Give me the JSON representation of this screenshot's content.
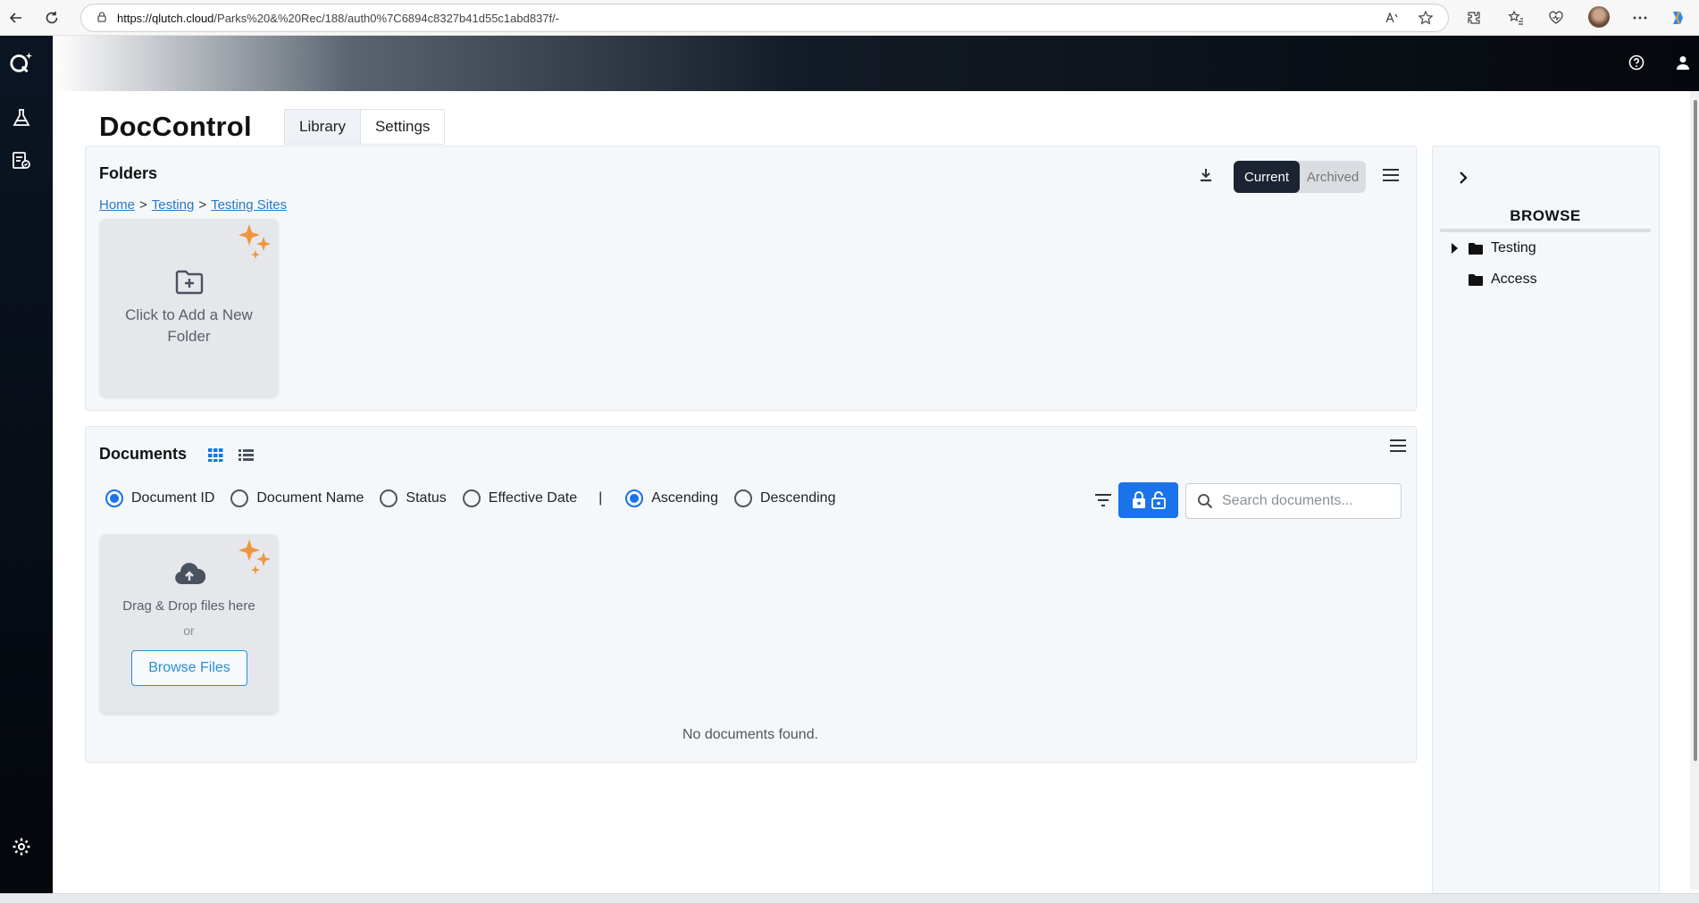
{
  "browser": {
    "url_host": "https://qlutch.cloud",
    "url_path": "/Parks%20&%20Rec/188/auth0%7C6894c8327b41d55c1abd837f/-"
  },
  "app": {
    "title": "DocControl",
    "tabs": [
      "Library",
      "Settings"
    ],
    "active_tab": "Library"
  },
  "folders": {
    "title": "Folders",
    "breadcrumb": [
      "Home",
      "Testing",
      "Testing Sites"
    ],
    "breadcrumb_sep": ">",
    "add_folder_label": "Click to Add a New Folder",
    "toggle": {
      "current": "Current",
      "archived": "Archived",
      "selected": "Current"
    }
  },
  "documents": {
    "title": "Documents",
    "sort_fields": [
      "Document ID",
      "Document Name",
      "Status",
      "Effective Date"
    ],
    "sort_field_selected": "Document ID",
    "sort_separator": "|",
    "sort_orders": [
      "Ascending",
      "Descending"
    ],
    "sort_order_selected": "Ascending",
    "search_placeholder": "Search documents...",
    "drop_label": "Drag & Drop files here",
    "or_label": "or",
    "browse_button": "Browse Files",
    "empty_message": "No documents found."
  },
  "browse": {
    "title": "BROWSE",
    "items": [
      {
        "label": "Testing",
        "expandable": true
      },
      {
        "label": "Access",
        "expandable": false
      }
    ]
  },
  "colors": {
    "accent": "#1a73e8",
    "toggle_active": "#1c2433",
    "sparkle": "#f0953a",
    "link": "#2b79c2"
  }
}
